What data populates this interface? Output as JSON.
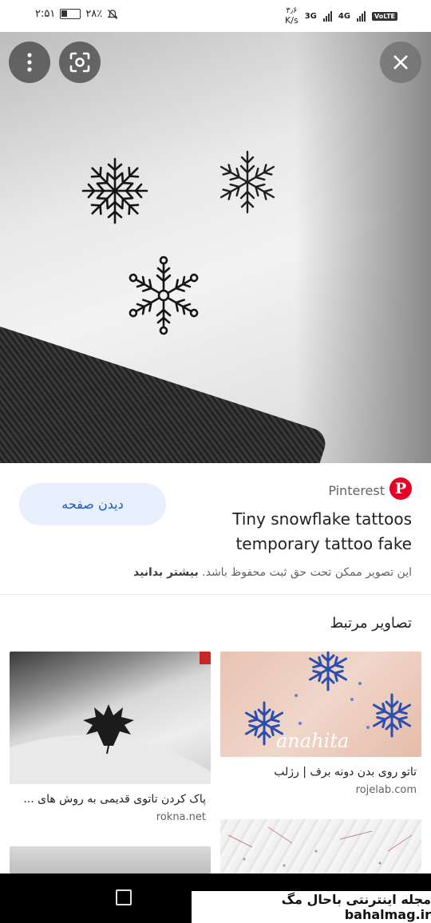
{
  "status_bar": {
    "time": "۲:۵۱",
    "battery": "۲۸٪",
    "speed_value": "۳٫۶",
    "speed_unit": "K/s",
    "network_1": "3G",
    "network_2": "4G",
    "volte": "VoLTE"
  },
  "hero": {
    "menu_icon": "vertical-dots-icon",
    "lens_icon": "lens-icon",
    "close_icon": "close-icon"
  },
  "result": {
    "visit_label": "دیدن صفحه",
    "source_name": "Pinterest",
    "source_logo_text": "P",
    "title": "Tiny snowflake tattoos temporary tattoo fake",
    "copyright_text": "این تصویر ممکن تحت حق ثبت محفوظ باشد.",
    "learn_more": "بیشتر بدانید"
  },
  "related": {
    "heading": "تصاویر مرتبط",
    "items": [
      {
        "caption": "تاتو روی بدن دونه برف | رژلب",
        "domain": "rojelab.com",
        "thumb_text": "anahita"
      },
      {
        "caption": "پاک کردن تاتوی قدیمی به روش های ...",
        "domain": "rokna.net"
      }
    ]
  },
  "watermark": "مجله اینترنتی باحال مگ bahalmag.ir"
}
